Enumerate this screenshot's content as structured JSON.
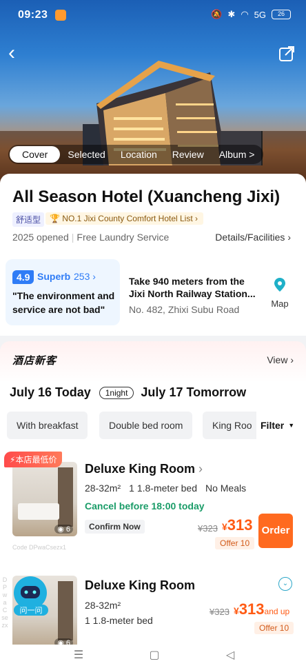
{
  "status_bar": {
    "time": "09:23",
    "battery": "26",
    "signal_label": "5G"
  },
  "header": {
    "back_icon": "back-arrow-icon",
    "share_icon": "share-icon"
  },
  "media_tabs": [
    "Cover",
    "Selected",
    "Location",
    "Review",
    "Album"
  ],
  "media_tabs_more": ">",
  "hotel": {
    "name": "All Season Hotel (Xuancheng Jixi)",
    "type_tag": "舒适型",
    "rank_tag": "NO.1 Jixi County Comfort Hotel List",
    "opened": "2025 opened",
    "facility": "Free Laundry Service",
    "details_link": "Details/Facilities"
  },
  "review": {
    "score": "4.9",
    "label": "Superb",
    "count": "253",
    "quote": "\"The environment and service are not bad\""
  },
  "location": {
    "distance": "Take 940 meters from the Jixi North Railway Station...",
    "address": "No. 482, Zhixi Subu Road",
    "map_label": "Map"
  },
  "rooms_section": {
    "brand": "酒店新客",
    "view_link": "View",
    "checkin": "July 16 Today",
    "nights": "1night",
    "checkout": "July 17 Tomorrow",
    "filters": [
      "With breakfast",
      "Double bed room",
      "King Roo"
    ],
    "filter_button": "Filter"
  },
  "rooms": [
    {
      "promo_tag": "本店最低价",
      "title": "Deluxe King Room",
      "size": "28-32m²",
      "bed": "1 1.8-meter bed",
      "meals": "No Meals",
      "cancel": "Cancel before 18:00 today",
      "confirm": "Confirm Now",
      "old_price": "¥323",
      "currency": "¥",
      "price": "313",
      "offer": "Offer 10",
      "order_label": "Order",
      "photo_count": "6",
      "code": "Code DPwaCsezx1"
    },
    {
      "title": "Deluxe King Room",
      "size": "28-32m²",
      "bed": "1 1.8-meter bed",
      "old_price": "¥323",
      "currency": "¥",
      "price": "313",
      "price_suffix": "and up",
      "offer": "Offer 10",
      "photo_count": "6",
      "bot_label": "问一问",
      "vertical_code": "DPwaCsezx"
    }
  ],
  "colors": {
    "accent_orange": "#ff6a1f",
    "price_orange": "#ff5b14",
    "score_blue": "#2f7cf6",
    "cancel_green": "#1a9c68"
  }
}
